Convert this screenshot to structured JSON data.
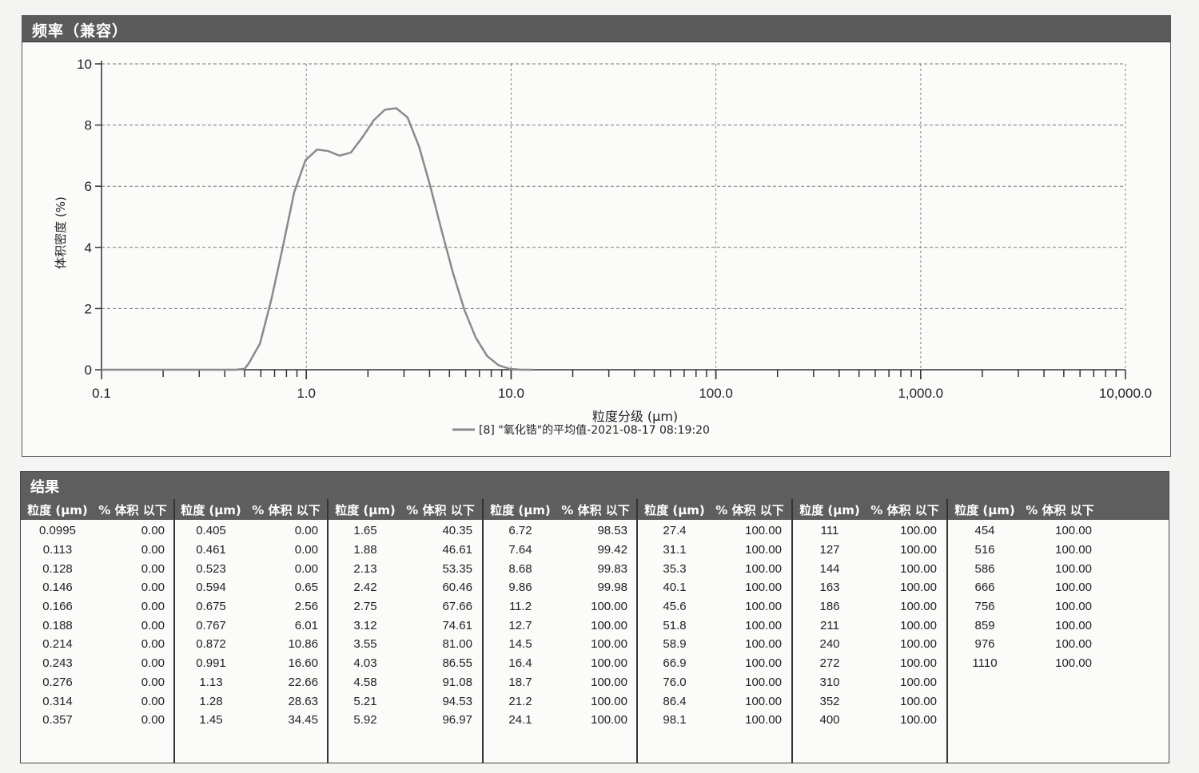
{
  "chart_panel": {
    "title": "频率（兼容）"
  },
  "chart_data": {
    "type": "line",
    "x_scale": "log",
    "xlim": [
      0.1,
      10000
    ],
    "ylim": [
      0,
      10
    ],
    "xlabel": "粒度分级 (μm)",
    "ylabel": "体积密度 (%)",
    "x_tick_labels": [
      "0.1",
      "1.0",
      "10.0",
      "100.0",
      "1,000.0",
      "10,000.0"
    ],
    "x_tick_values": [
      0.1,
      1,
      10,
      100,
      1000,
      10000
    ],
    "y_ticks": [
      0,
      2,
      4,
      6,
      8,
      10
    ],
    "grid": true,
    "legend": {
      "position": "bottom-center",
      "entries": [
        "[8] \"氧化锆\"的平均值-2021-08-17 08:19:20"
      ]
    },
    "series": [
      {
        "name": "[8] \"氧化锆\"的平均值-2021-08-17 08:19:20",
        "color": "#8a8a8a",
        "x": [
          0.1,
          0.3,
          0.45,
          0.5,
          0.523,
          0.594,
          0.675,
          0.767,
          0.872,
          0.991,
          1.13,
          1.28,
          1.45,
          1.65,
          1.88,
          2.13,
          2.42,
          2.75,
          3.12,
          3.55,
          4.03,
          4.58,
          5.21,
          5.92,
          6.72,
          7.64,
          8.68,
          9.86,
          11.2,
          12.7
        ],
        "y": [
          0,
          0,
          0,
          0.03,
          0.2,
          0.85,
          2.3,
          4.0,
          5.8,
          6.85,
          7.2,
          7.15,
          7.0,
          7.1,
          7.6,
          8.15,
          8.5,
          8.55,
          8.25,
          7.3,
          6.0,
          4.55,
          3.15,
          1.95,
          1.05,
          0.45,
          0.15,
          0.03,
          0,
          0
        ]
      }
    ]
  },
  "results": {
    "title": "结果",
    "col_size_label": "粒度 (μm)",
    "col_pct_label": "% 体积 以下",
    "groups": [
      {
        "rows": [
          [
            "0.0995",
            "0.00"
          ],
          [
            "0.113",
            "0.00"
          ],
          [
            "0.128",
            "0.00"
          ],
          [
            "0.146",
            "0.00"
          ],
          [
            "0.166",
            "0.00"
          ],
          [
            "0.188",
            "0.00"
          ],
          [
            "0.214",
            "0.00"
          ],
          [
            "0.243",
            "0.00"
          ],
          [
            "0.276",
            "0.00"
          ],
          [
            "0.314",
            "0.00"
          ],
          [
            "0.357",
            "0.00"
          ]
        ]
      },
      {
        "rows": [
          [
            "0.405",
            "0.00"
          ],
          [
            "0.461",
            "0.00"
          ],
          [
            "0.523",
            "0.00"
          ],
          [
            "0.594",
            "0.65"
          ],
          [
            "0.675",
            "2.56"
          ],
          [
            "0.767",
            "6.01"
          ],
          [
            "0.872",
            "10.86"
          ],
          [
            "0.991",
            "16.60"
          ],
          [
            "1.13",
            "22.66"
          ],
          [
            "1.28",
            "28.63"
          ],
          [
            "1.45",
            "34.45"
          ]
        ]
      },
      {
        "rows": [
          [
            "1.65",
            "40.35"
          ],
          [
            "1.88",
            "46.61"
          ],
          [
            "2.13",
            "53.35"
          ],
          [
            "2.42",
            "60.46"
          ],
          [
            "2.75",
            "67.66"
          ],
          [
            "3.12",
            "74.61"
          ],
          [
            "3.55",
            "81.00"
          ],
          [
            "4.03",
            "86.55"
          ],
          [
            "4.58",
            "91.08"
          ],
          [
            "5.21",
            "94.53"
          ],
          [
            "5.92",
            "96.97"
          ]
        ]
      },
      {
        "rows": [
          [
            "6.72",
            "98.53"
          ],
          [
            "7.64",
            "99.42"
          ],
          [
            "8.68",
            "99.83"
          ],
          [
            "9.86",
            "99.98"
          ],
          [
            "11.2",
            "100.00"
          ],
          [
            "12.7",
            "100.00"
          ],
          [
            "14.5",
            "100.00"
          ],
          [
            "16.4",
            "100.00"
          ],
          [
            "18.7",
            "100.00"
          ],
          [
            "21.2",
            "100.00"
          ],
          [
            "24.1",
            "100.00"
          ]
        ]
      },
      {
        "rows": [
          [
            "27.4",
            "100.00"
          ],
          [
            "31.1",
            "100.00"
          ],
          [
            "35.3",
            "100.00"
          ],
          [
            "40.1",
            "100.00"
          ],
          [
            "45.6",
            "100.00"
          ],
          [
            "51.8",
            "100.00"
          ],
          [
            "58.9",
            "100.00"
          ],
          [
            "66.9",
            "100.00"
          ],
          [
            "76.0",
            "100.00"
          ],
          [
            "86.4",
            "100.00"
          ],
          [
            "98.1",
            "100.00"
          ]
        ]
      },
      {
        "rows": [
          [
            "111",
            "100.00"
          ],
          [
            "127",
            "100.00"
          ],
          [
            "144",
            "100.00"
          ],
          [
            "163",
            "100.00"
          ],
          [
            "186",
            "100.00"
          ],
          [
            "211",
            "100.00"
          ],
          [
            "240",
            "100.00"
          ],
          [
            "272",
            "100.00"
          ],
          [
            "310",
            "100.00"
          ],
          [
            "352",
            "100.00"
          ],
          [
            "400",
            "100.00"
          ]
        ]
      },
      {
        "rows": [
          [
            "454",
            "100.00"
          ],
          [
            "516",
            "100.00"
          ],
          [
            "586",
            "100.00"
          ],
          [
            "666",
            "100.00"
          ],
          [
            "756",
            "100.00"
          ],
          [
            "859",
            "100.00"
          ],
          [
            "976",
            "100.00"
          ],
          [
            "1110",
            "100.00"
          ]
        ]
      }
    ]
  }
}
